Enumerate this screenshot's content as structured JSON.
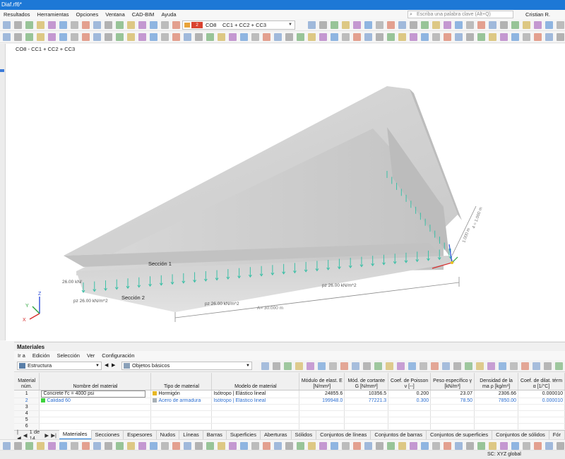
{
  "window": {
    "title": "Diaf.rf6*"
  },
  "menu": [
    "Resultados",
    "Herramientas",
    "Opciones",
    "Ventana",
    "CAD-BIM",
    "Ayuda"
  ],
  "search": {
    "placeholder": "Escriba una palabra clave (Alt+Q)"
  },
  "user": "Cristian R. Repett",
  "load_combo": {
    "number": "2",
    "code": "CO8",
    "description": "CC1 + CC2 + CC3"
  },
  "viewport": {
    "caption": "CO8 - CC1 + CC2 + CC3",
    "labels": {
      "section1": "Sección 1",
      "section2": "Sección 2",
      "load_left": "26.00 kN/",
      "load_pz_left": "pz 26.00 kN/m^2",
      "load_pz_mid": "pz 26.00 kN/m^2",
      "load_pz_right": "pz 26.00 kN/m^2",
      "dim_length": "A= 30.000 m",
      "dim_side1": "1.000 m",
      "dim_side2": "4 = 1.000 m",
      "axis_x": "X",
      "axis_y": "Y",
      "axis_z": "Z"
    },
    "colors": {
      "structure": "#cfcfcf",
      "loads": "#3bbfa6",
      "dimension": "#8a8a8a"
    }
  },
  "panel": {
    "title": "Materiales",
    "menu": [
      "Ir a",
      "Edición",
      "Selección",
      "Ver",
      "Configuración"
    ],
    "combo_structure": "Estructura",
    "combo_objects": "Objetos básicos"
  },
  "table": {
    "headers": [
      "Material núm.",
      "Nombre del material",
      "Tipo de material",
      "Modelo de material",
      "Módulo de elast. E [N/mm²]",
      "Mód. de cortante G [N/mm²]",
      "Coef. de Poisson ν [--]",
      "Peso específico γ [kN/m³]",
      "Densidad de la ma ρ [kg/m³]",
      "Coef. de dilat. térm α [1/°C]"
    ],
    "rows": [
      {
        "num": "1",
        "name": "Concrete f'c = 4000 psi",
        "name_color": "",
        "type": "Hormigón",
        "type_color": "#e7b824",
        "model": "Isótropo | Elástico lineal",
        "E": "24855.6",
        "G": "10356.5",
        "nu": "0.200",
        "gamma": "23.07",
        "rho": "2306.66",
        "alpha": "0.000010"
      },
      {
        "num": "2",
        "name": "Calidad 60",
        "name_color": "#3ed33e",
        "type": "Acero de armadura",
        "type_color": "#a8b0b6",
        "model": "Isótropo | Elástico lineal",
        "E": "199948.0",
        "G": "77221.3",
        "nu": "0.300",
        "gamma": "78.50",
        "rho": "7850.00",
        "alpha": "0.000010"
      },
      {
        "num": "3",
        "name": "",
        "name_color": "",
        "type": "",
        "type_color": "",
        "model": "",
        "E": "",
        "G": "",
        "nu": "",
        "gamma": "",
        "rho": "",
        "alpha": ""
      },
      {
        "num": "4",
        "name": "",
        "name_color": "",
        "type": "",
        "type_color": "",
        "model": "",
        "E": "",
        "G": "",
        "nu": "",
        "gamma": "",
        "rho": "",
        "alpha": ""
      },
      {
        "num": "5",
        "name": "",
        "name_color": "",
        "type": "",
        "type_color": "",
        "model": "",
        "E": "",
        "G": "",
        "nu": "",
        "gamma": "",
        "rho": "",
        "alpha": ""
      },
      {
        "num": "6",
        "name": "",
        "name_color": "",
        "type": "",
        "type_color": "",
        "model": "",
        "E": "",
        "G": "",
        "nu": "",
        "gamma": "",
        "rho": "",
        "alpha": ""
      }
    ]
  },
  "pager": {
    "label": "1 de 14"
  },
  "tabs": [
    "Materiales",
    "Secciones",
    "Espesores",
    "Nudos",
    "Líneas",
    "Barras",
    "Superficies",
    "Aberturas",
    "Sólidos",
    "Conjuntos de líneas",
    "Conjuntos de barras",
    "Conjuntos de superficies",
    "Conjuntos de sólidos",
    "Fór"
  ],
  "status": {
    "coordinate_system": "SC: XYZ global"
  }
}
